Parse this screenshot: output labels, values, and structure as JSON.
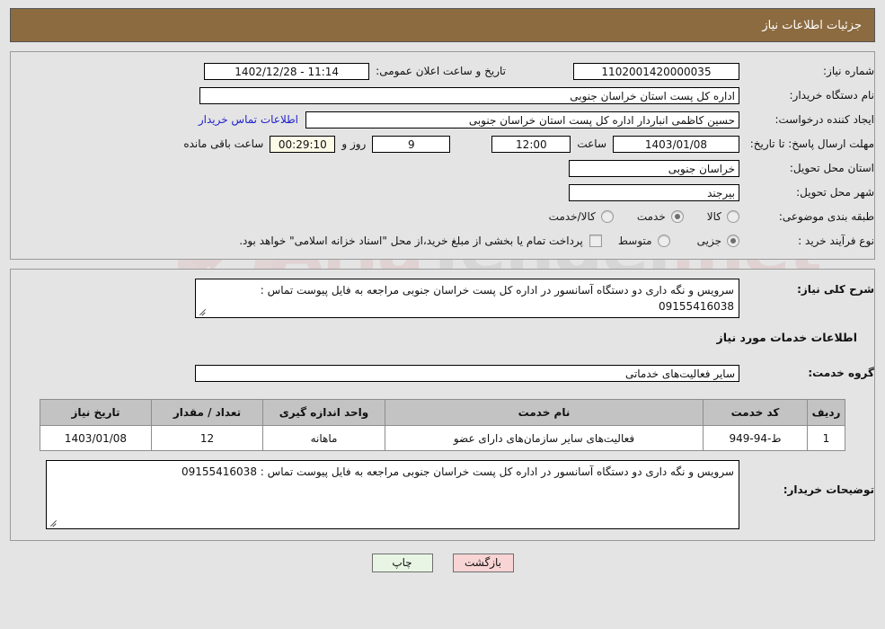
{
  "header": {
    "title": "جزئیات اطلاعات نیاز",
    "bar_color": "#8c6b40"
  },
  "watermark": {
    "text_left": "Aria",
    "text_right": "Tender",
    "suffix": ".net"
  },
  "form": {
    "need_number_label": "شماره نیاز:",
    "need_number_value": "1102001420000035",
    "announce_label": "تاریخ و ساعت اعلان عمومی:",
    "announce_value": "11:14 - 1402/12/28",
    "buyer_org_label": "نام دستگاه خریدار:",
    "buyer_org_value": "اداره کل پست استان خراسان جنوبی",
    "requester_label": "ایجاد کننده درخواست:",
    "requester_value": "حسین کاظمی انباردار اداره کل پست استان خراسان جنوبی",
    "contact_link": "اطلاعات تماس خریدار",
    "deadline_label": "مهلت ارسال پاسخ: تا تاریخ:",
    "deadline_date": "1403/01/08",
    "hour_label": "ساعت",
    "hour_value": "12:00",
    "days_value": "9",
    "days_label": "روز و",
    "countdown_value": "00:29:10",
    "countdown_label": "ساعت باقی مانده",
    "province_label": "استان محل تحویل:",
    "province_value": "خراسان جنوبی",
    "city_label": "شهر محل تحویل:",
    "city_value": "بیرجند",
    "category_label": "طبقه بندی موضوعی:",
    "category_options": [
      {
        "label": "کالا",
        "selected": false
      },
      {
        "label": "خدمت",
        "selected": true
      },
      {
        "label": "کالا/خدمت",
        "selected": false
      }
    ],
    "process_label": "نوع فرآیند خرید :",
    "process_options": [
      {
        "label": "جزیی",
        "selected": true
      },
      {
        "label": "متوسط",
        "selected": false
      }
    ],
    "treasury_checkbox_checked": false,
    "treasury_text": "پرداخت تمام یا بخشی از مبلغ خرید،از محل \"اسناد خزانه اسلامی\" خواهد بود."
  },
  "description": {
    "label": "شرح کلی نیاز:",
    "value": "سرویس و نگه داری دو دستگاه آسانسور در اداره کل پست خراسان جنوبی مراجعه به فایل پیوست تماس : 09155416038"
  },
  "services": {
    "section_title": "اطلاعات خدمات مورد نیاز",
    "group_label": "گروه خدمت:",
    "group_value": "سایر فعالیت‌های خدماتی",
    "table": {
      "columns": [
        "ردیف",
        "کد خدمت",
        "نام خدمت",
        "واحد اندازه گیری",
        "تعداد / مقدار",
        "تاریخ نیاز"
      ],
      "rows": [
        {
          "row_no": "1",
          "service_code": "ط-94-949",
          "service_name": "فعالیت‌های سایر سازمان‌های دارای عضو",
          "unit": "ماهانه",
          "quantity": "12",
          "need_date": "1403/01/08"
        }
      ]
    }
  },
  "buyer_notes": {
    "label": "توضیحات خریدار:",
    "value": "سرویس و نگه داری دو دستگاه آسانسور در اداره کل پست خراسان جنوبی مراجعه به فایل پیوست تماس : 09155416038"
  },
  "footer": {
    "print_label": "چاپ",
    "back_label": "بازگشت"
  }
}
